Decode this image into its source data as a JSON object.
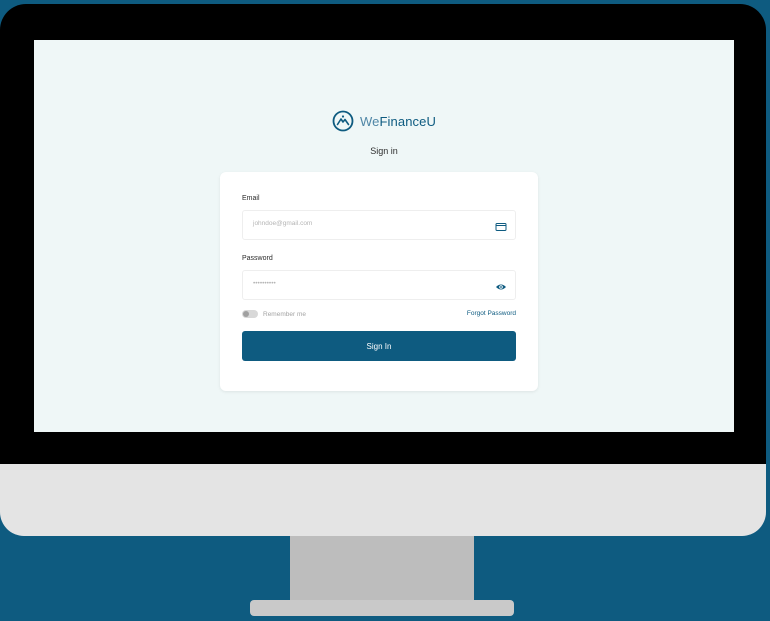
{
  "brand": {
    "name_prefix": "We",
    "name_suffix": "FinanceU",
    "logo_icon": "mountain-circle-icon",
    "color": "#0e5b80"
  },
  "page": {
    "title": "Sign in",
    "background": "#0e5b80",
    "screen_background": "#eff7f7"
  },
  "form": {
    "email": {
      "label": "Email",
      "value": "johndoe@gmail.com",
      "icon": "email-icon"
    },
    "password": {
      "label": "Password",
      "value": "••••••••••",
      "icon": "eye-icon"
    },
    "remember": {
      "label": "Remember me",
      "checked": false
    },
    "forgot_label": "Forgot Password",
    "submit_label": "Sign In"
  }
}
